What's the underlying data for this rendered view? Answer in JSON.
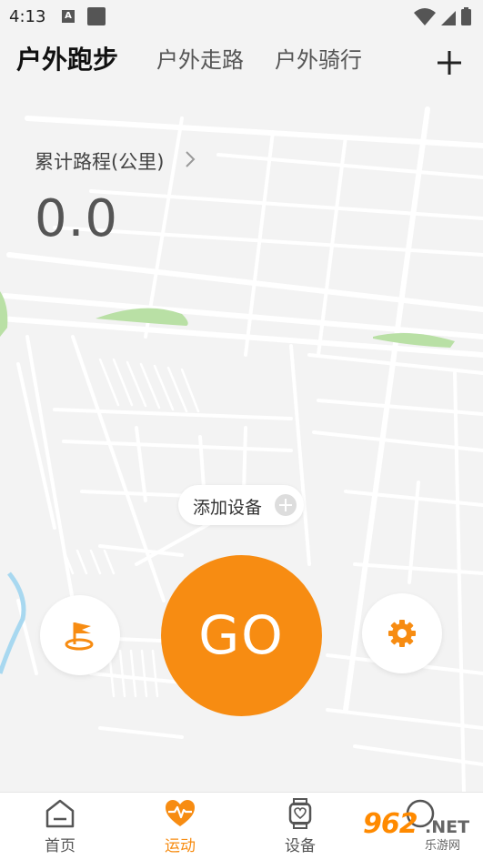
{
  "status_bar": {
    "time": "4:13",
    "sim_letter": "A"
  },
  "tabs": [
    {
      "label": "户外跑步",
      "active": true
    },
    {
      "label": "户外走路",
      "active": false
    },
    {
      "label": "户外骑行",
      "active": false
    }
  ],
  "distance": {
    "label": "累计路程(公里)",
    "value": "0.0"
  },
  "add_device": {
    "label": "添加设备"
  },
  "go_button": {
    "label": "GO"
  },
  "bottom_nav": [
    {
      "label": "首页",
      "icon": "home-icon",
      "active": false
    },
    {
      "label": "运动",
      "icon": "heart-pulse-icon",
      "active": true
    },
    {
      "label": "设备",
      "icon": "watch-icon",
      "active": false
    },
    {
      "label": "",
      "icon": "profile-icon",
      "active": false
    }
  ],
  "watermark": {
    "number": "962",
    "domain": ".NET",
    "name": "乐游网"
  },
  "colors": {
    "accent": "#f78c12",
    "background": "#f3f3f3",
    "map_road": "#ffffff",
    "map_park": "#b9e0a5",
    "map_water": "#a8d8f0"
  }
}
